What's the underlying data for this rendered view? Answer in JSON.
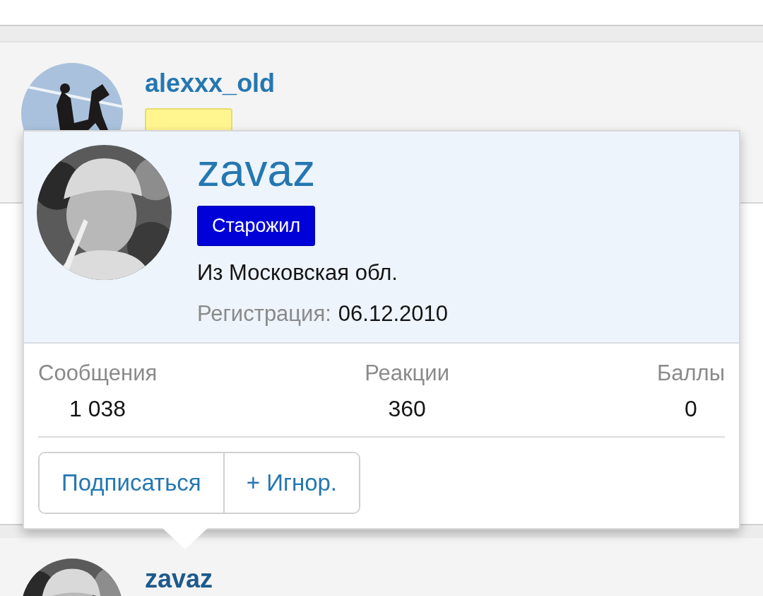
{
  "posts": [
    {
      "author": "alexxx_old",
      "badge_visible": true
    },
    {
      "author": "zavaz"
    }
  ],
  "member_tooltip": {
    "username": "zavaz",
    "badge": "Старожил",
    "location": "Из Московская обл.",
    "registration_label": "Регистрация:",
    "registration_date": "06.12.2010",
    "stats": [
      {
        "label": "Сообщения",
        "value": "1 038"
      },
      {
        "label": "Реакции",
        "value": "360"
      },
      {
        "label": "Баллы",
        "value": "0"
      }
    ],
    "buttons": [
      "Подписаться",
      "+ Игнор."
    ]
  }
}
